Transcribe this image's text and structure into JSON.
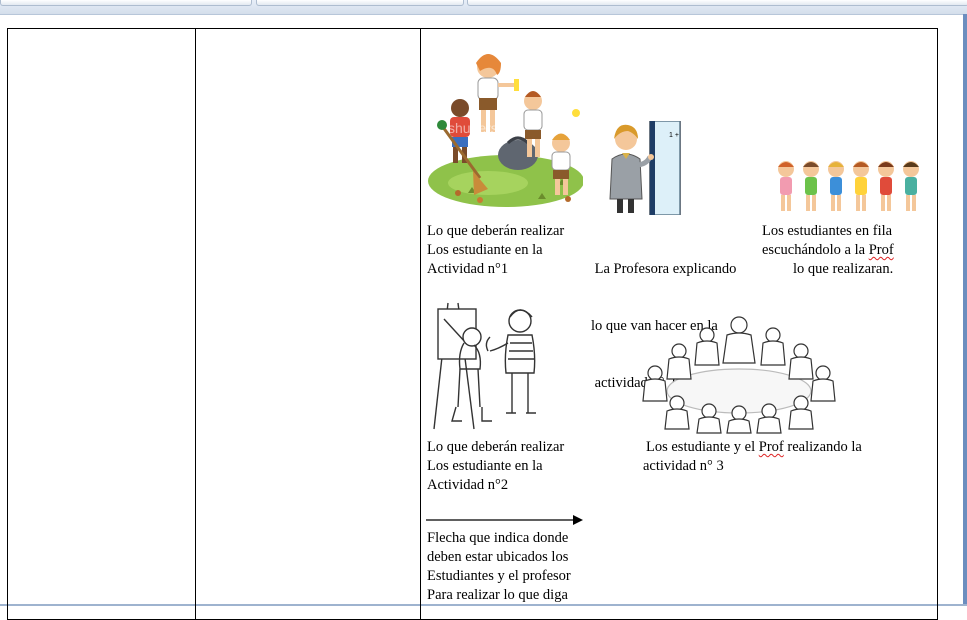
{
  "activity_cell": {
    "caption_1": {
      "lines": [
        "Lo que deberán realizar",
        "Los estudiante en la",
        "Actividad n°1"
      ]
    },
    "caption_2": {
      "lines": [
        " La Profesora explicando",
        "lo que van hacer en la",
        " actividad n° 2"
      ]
    },
    "caption_3": {
      "line1": "Los estudiantes en fila",
      "line2_before": "escuchándolo a la ",
      "line2_flagged": "Prof",
      "line3": "lo que realizaran."
    },
    "caption_4": {
      "lines": [
        "Lo que deberán realizar",
        "Los estudiante en la",
        "Actividad n°2"
      ]
    },
    "caption_5": {
      "line1_before": "Los estudiante y el ",
      "line1_flagged": "Prof",
      "line1_after": " realizando la",
      "line2": "actividad n° 3"
    },
    "caption_6": {
      "lines": [
        "Flecha que indica donde",
        "deben estar ubicados los",
        "Estudiantes y el profesor",
        "Para realizar  lo que diga"
      ]
    },
    "watermark": "shutterstock",
    "board_text": "1 +",
    "illustrations": [
      "children-cleaning-park",
      "teacher-at-whiteboard",
      "children-in-line",
      "children-painting-easel",
      "group-sitting-in-circle",
      "arrow-right"
    ]
  }
}
